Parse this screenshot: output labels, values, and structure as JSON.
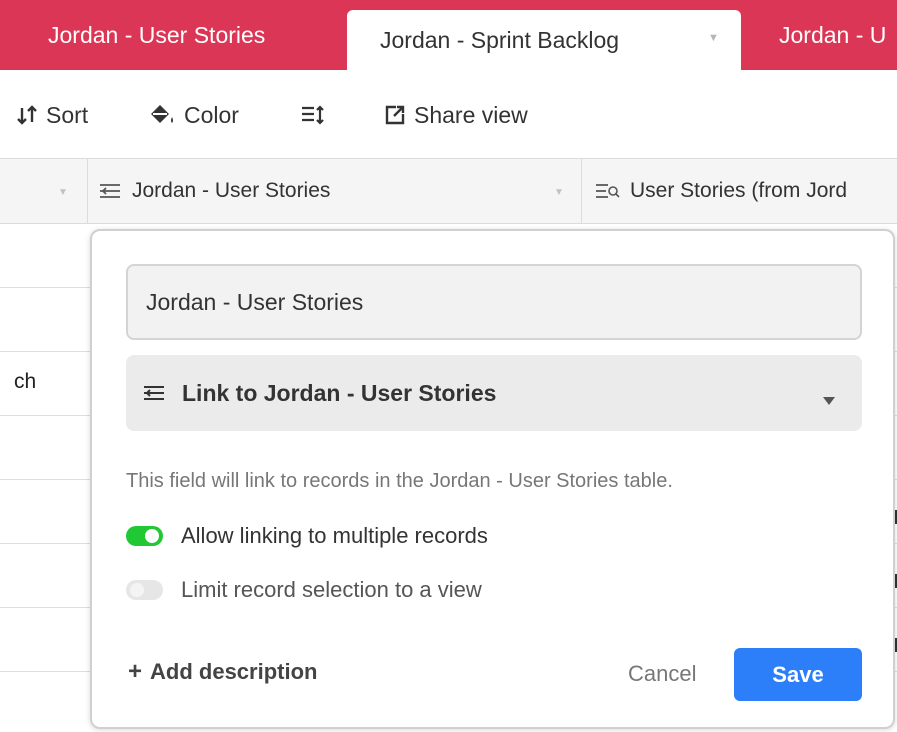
{
  "tabs": [
    {
      "label": "Jordan - User Stories"
    },
    {
      "label": "Jordan - Sprint Backlog"
    },
    {
      "label": "Jordan - U"
    }
  ],
  "toolbar": {
    "sort_label": "Sort",
    "color_label": "Color",
    "share_label": "Share view"
  },
  "grid": {
    "columns": [
      {
        "label": ""
      },
      {
        "label": "Jordan - User Stories",
        "icon": "link-field-icon"
      },
      {
        "label": "User Stories (from Jord",
        "icon": "lookup-field-icon"
      }
    ],
    "rows": [
      "",
      "",
      "ch",
      "",
      "",
      "",
      ""
    ]
  },
  "popup": {
    "field_name": "Jordan - User Stories",
    "field_type": "Link to Jordan - User Stories",
    "description": "This field will link to records in the Jordan - User Stories table.",
    "options": [
      {
        "label": "Allow linking to multiple records",
        "enabled": true
      },
      {
        "label": "Limit record selection to a view",
        "enabled": false
      }
    ],
    "add_description_label": "Add description",
    "cancel_label": "Cancel",
    "save_label": "Save"
  },
  "colors": {
    "tabbar": "#db3655",
    "toggle_on": "#20c933",
    "save_button": "#2d7ff9"
  }
}
